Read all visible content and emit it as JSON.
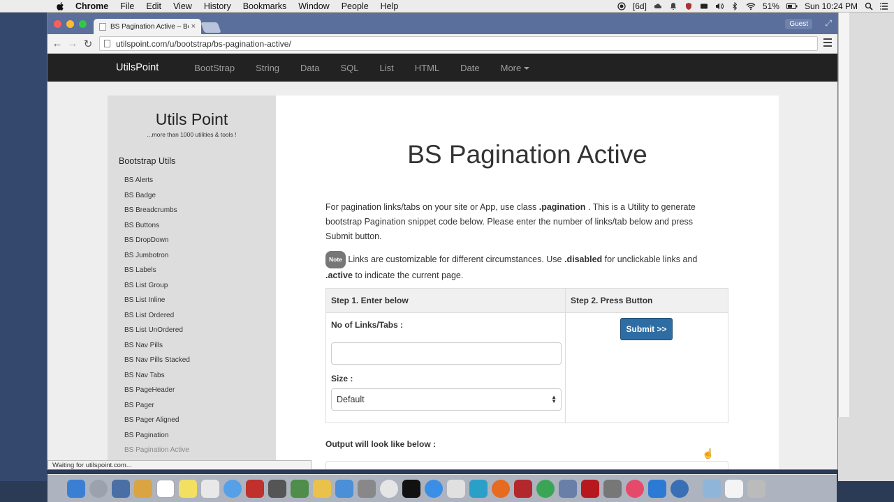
{
  "menubar": {
    "app": "Chrome",
    "items": [
      "File",
      "Edit",
      "View",
      "History",
      "Bookmarks",
      "Window",
      "People",
      "Help"
    ],
    "right": {
      "badge": "[6d]",
      "battery": "51%",
      "clock": "Sun 10:24 PM"
    }
  },
  "browser": {
    "tab_title": "BS Pagination Active – Boo",
    "guest_label": "Guest",
    "url": "utilspoint.com/u/bootstrap/bs-pagination-active/",
    "status": "Waiting for utilspoint.com..."
  },
  "site": {
    "brand": "UtilsPoint",
    "nav": [
      "BootStrap",
      "String",
      "Data",
      "SQL",
      "List",
      "HTML",
      "Date",
      "More"
    ]
  },
  "sidebar": {
    "title": "Utils Point",
    "subtitle": "...more than 1000 utilities & tools !",
    "section": "Bootstrap Utils",
    "items": [
      "BS Alerts",
      "BS Badge",
      "BS Breadcrumbs",
      "BS Buttons",
      "BS DropDown",
      "BS Jumbotron",
      "BS Labels",
      "BS List Group",
      "BS List Inline",
      "BS List Ordered",
      "BS List UnOrdered",
      "BS Nav Pills",
      "BS Nav Pills Stacked",
      "BS Nav Tabs",
      "BS PageHeader",
      "BS Pager",
      "BS Pager Aligned",
      "BS Pagination",
      "BS Pagination Active"
    ]
  },
  "main": {
    "title": "BS Pagination Active",
    "intro_a": "For pagination links/tabs on your site or App, use class ",
    "intro_class": ".pagination",
    "intro_b": " . This is a Utility to generate bootstrap Pagination snippet code below. Please enter the number of links/tab below and press Submit button.",
    "note_badge": "Note",
    "note_a": " Links are customizable for different circumstances. Use ",
    "note_disabled": ".disabled",
    "note_b": " for unclickable links and ",
    "note_active": ".active",
    "note_c": " to indicate the current page.",
    "step1_header": "Step 1. Enter below",
    "step2_header": "Step 2. Press Button",
    "links_label": "No of Links/Tabs :",
    "links_value": "",
    "size_label": "Size :",
    "size_selected": "Default",
    "submit_label": "Submit >>",
    "output_label": "Output will look like below :"
  },
  "colors": {
    "navbar_bg": "#222222",
    "submit_bg": "#2e6da4",
    "sidebar_bg": "#dddddd"
  }
}
